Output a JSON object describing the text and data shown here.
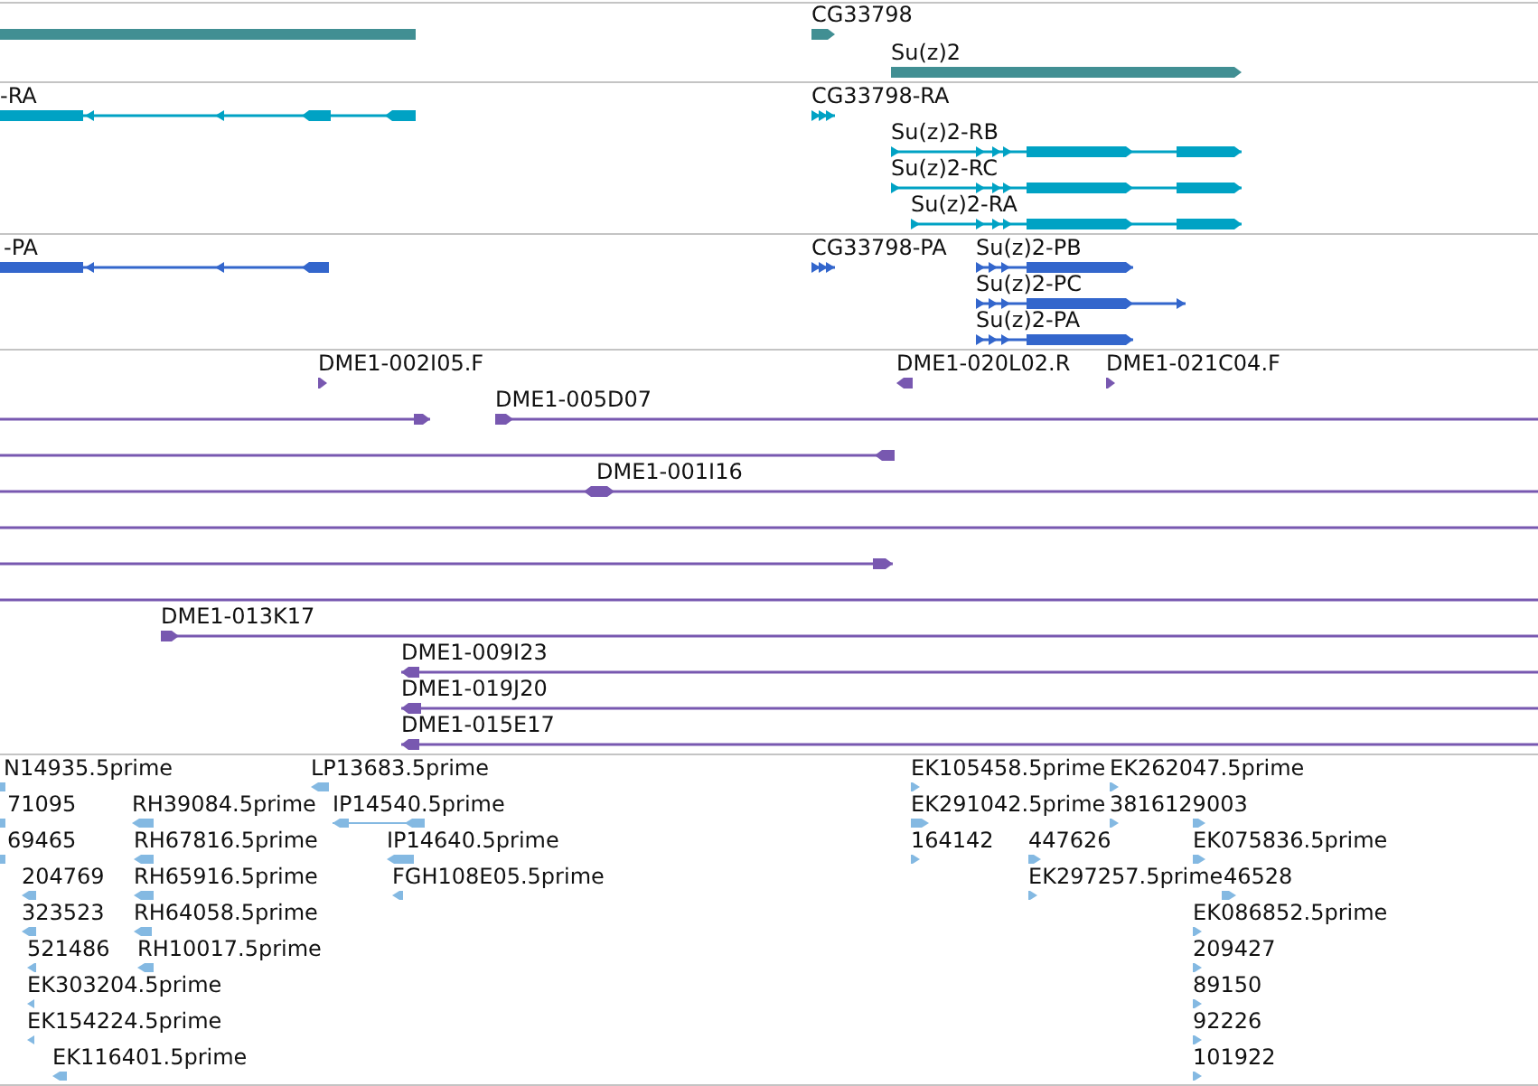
{
  "tracks": [
    {
      "kind": "gene",
      "color": "#418f93",
      "features": [
        {
          "reverse": true
        },
        {
          "label": "CG33798",
          "reverse": false
        },
        {
          "label": "Su(z)2",
          "reverse": false
        }
      ]
    },
    {
      "kind": "transcript",
      "color": "#00a2c4",
      "features": [
        {
          "label": "-RA",
          "reverse": true
        },
        {
          "label": "CG33798-RA",
          "reverse": false
        },
        {
          "label": "Su(z)2-RB",
          "reverse": false
        },
        {
          "label": "Su(z)2-RC",
          "reverse": false
        },
        {
          "label": "Su(z)2-RA",
          "reverse": false
        }
      ]
    },
    {
      "kind": "protein",
      "color": "#3366cc",
      "features": [
        {
          "label": "-PA",
          "reverse": true
        },
        {
          "label": "CG33798-PA",
          "reverse": false
        },
        {
          "label": "Su(z)2-PB",
          "reverse": false
        },
        {
          "label": "Su(z)2-PC",
          "reverse": false
        },
        {
          "label": "Su(z)2-PA",
          "reverse": false
        }
      ]
    },
    {
      "kind": "bac",
      "color": "#7858b0",
      "features": [
        {
          "kind": "read",
          "label": "DME1-002I05.F",
          "reverse": false
        },
        {
          "kind": "read",
          "label": "DME1-020L02.R",
          "reverse": true
        },
        {
          "kind": "read",
          "label": "DME1-021C04.F",
          "reverse": false
        },
        {
          "kind": "clone",
          "reverse": false
        },
        {
          "kind": "clone",
          "label": "DME1-005D07",
          "reverse": false
        },
        {
          "kind": "clone",
          "reverse": true
        },
        {
          "kind": "clone",
          "label": "DME1-001I16"
        },
        {
          "kind": "clone"
        },
        {
          "kind": "clone",
          "reverse": false
        },
        {
          "kind": "clone"
        },
        {
          "kind": "clone",
          "label": "DME1-013K17",
          "reverse": false
        },
        {
          "kind": "clone",
          "label": "DME1-009I23",
          "reverse": true
        },
        {
          "kind": "clone",
          "label": "DME1-019J20",
          "reverse": true
        },
        {
          "kind": "clone",
          "label": "DME1-015E17",
          "reverse": true
        }
      ]
    },
    {
      "kind": "est",
      "color": "#84b9e2",
      "features": [
        {
          "label": "N14935.5prime",
          "reverse": true
        },
        {
          "label": "LP13683.5prime",
          "reverse": true
        },
        {
          "label": "EK105458.5prime",
          "reverse": false
        },
        {
          "label": "EK262047.5prime",
          "reverse": false
        },
        {
          "label": "71095",
          "reverse": true
        },
        {
          "label": "RH39084.5prime",
          "reverse": true
        },
        {
          "label": "IP14540.5prime",
          "reverse": true
        },
        {
          "label": "EK291042.5prime",
          "reverse": false
        },
        {
          "label": "3816129003",
          "reverse": false
        },
        {
          "reverse": false
        },
        {
          "label": "69465",
          "reverse": true
        },
        {
          "label": "RH67816.5prime",
          "reverse": true
        },
        {
          "label": "IP14640.5prime",
          "reverse": true
        },
        {
          "label": "164142",
          "reverse": false
        },
        {
          "label": "447626",
          "reverse": false
        },
        {
          "label": "EK075836.5prime",
          "reverse": false
        },
        {
          "label": "204769",
          "reverse": true
        },
        {
          "label": "RH65916.5prime",
          "reverse": true
        },
        {
          "label": "FGH108E05.5prime",
          "reverse": true
        },
        {
          "label": "EK297257.5prime",
          "reverse": false
        },
        {
          "label": "46528",
          "reverse": false
        },
        {
          "label": "323523",
          "reverse": true
        },
        {
          "label": "RH64058.5prime",
          "reverse": true
        },
        {
          "label": "EK086852.5prime",
          "reverse": false
        },
        {
          "label": "521486",
          "reverse": true
        },
        {
          "label": "RH10017.5prime",
          "reverse": true
        },
        {
          "label": "209427",
          "reverse": false
        },
        {
          "label": "EK303204.5prime",
          "reverse": true
        },
        {
          "label": "89150",
          "reverse": false
        },
        {
          "label": "EK154224.5prime",
          "reverse": true
        },
        {
          "label": "92226",
          "reverse": false
        },
        {
          "label": "EK116401.5prime",
          "reverse": true
        },
        {
          "label": "101922",
          "reverse": false
        }
      ]
    }
  ]
}
